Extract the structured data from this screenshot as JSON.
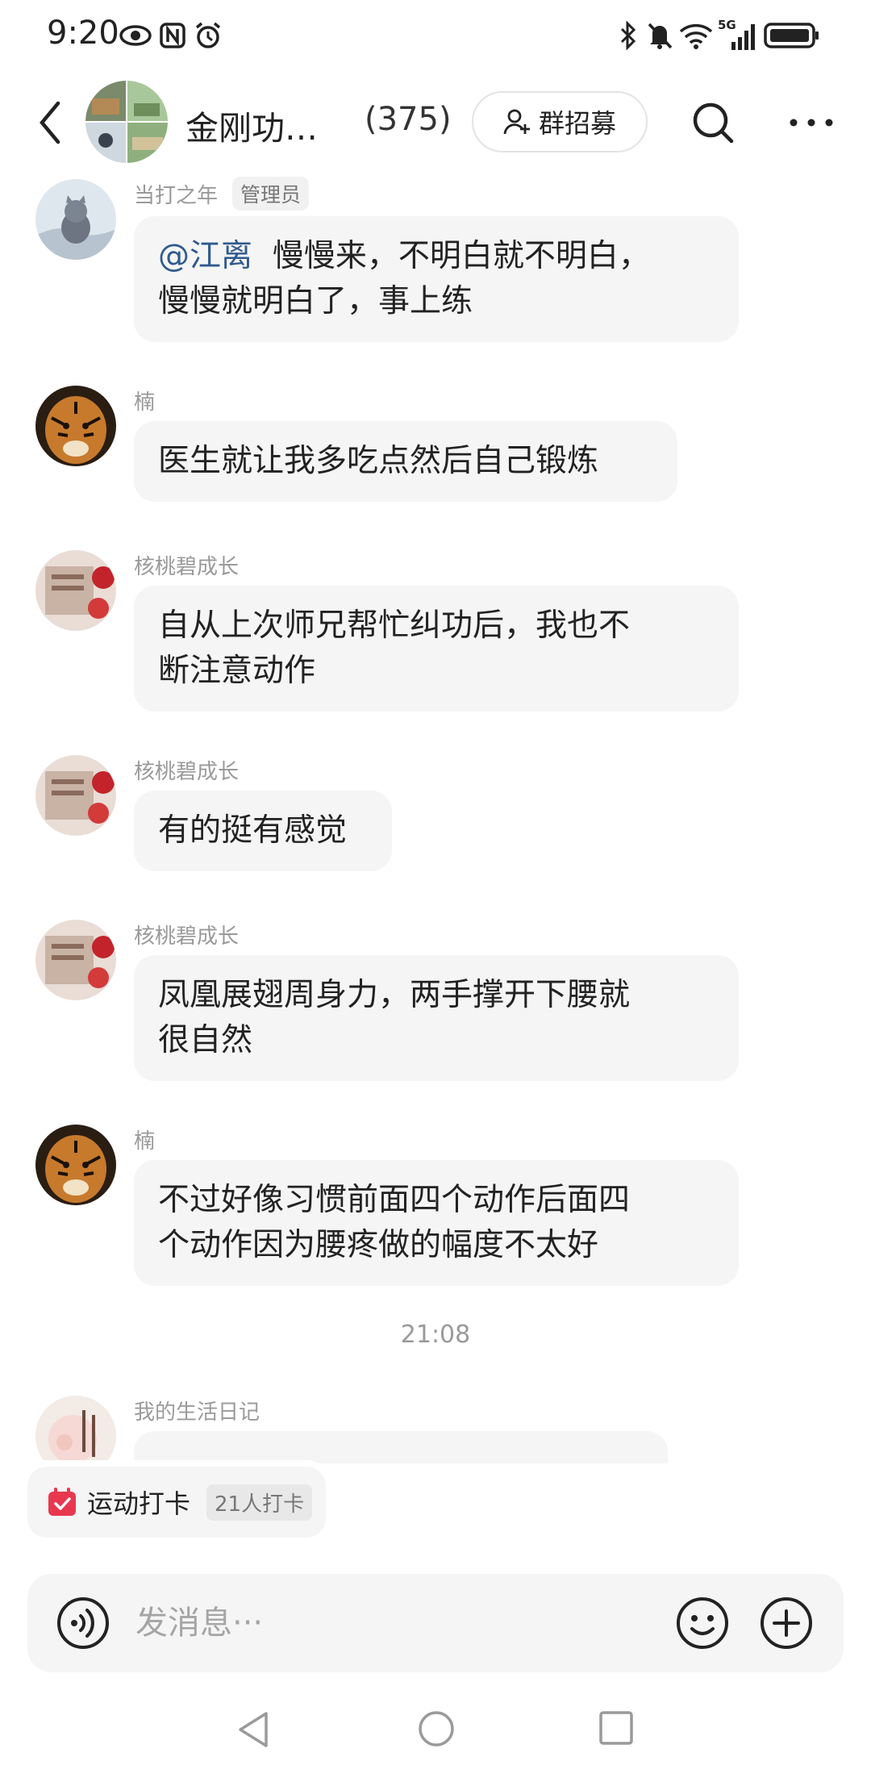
{
  "status_bar": {
    "time": "9:20",
    "icons": [
      "eye-icon",
      "nfc-icon",
      "alarm-icon",
      "bluetooth-icon",
      "mute-icon",
      "wifi-icon",
      "signal-5g-icon",
      "battery-icon"
    ],
    "network": "5G"
  },
  "header": {
    "group_name": "金刚功…",
    "member_count": "(375)",
    "recruit_label": "群招募"
  },
  "messages": [
    {
      "sender": "当打之年",
      "role": "管理员",
      "mention": "@江离",
      "text_line1": "慢慢来，不明白就不明白，",
      "text_line2": "慢慢就明白了，事上练"
    },
    {
      "sender": "楠",
      "text_line1": "医生就让我多吃点然后自己锻炼"
    },
    {
      "sender": "核桃碧成长",
      "text_line1": "自从上次师兄帮忙纠功后，我也不",
      "text_line2": "断注意动作"
    },
    {
      "sender": "核桃碧成长",
      "text_line1": "有的挺有感觉"
    },
    {
      "sender": "核桃碧成长",
      "text_line1": "凤凰展翅周身力，两手撑开下腰就",
      "text_line2": "很自然"
    },
    {
      "sender": "楠",
      "text_line1": "不过好像习惯前面四个动作后面四",
      "text_line2": "个动作因为腰疼做的幅度不太好"
    }
  ],
  "timestamp": "21:08",
  "partial_message": {
    "sender": "我的生活日记"
  },
  "checkin": {
    "label": "运动打卡",
    "count": "21人打卡"
  },
  "input": {
    "placeholder": "发消息···"
  },
  "colors": {
    "mention": "#2f5a8e",
    "bubble": "#f5f5f5",
    "checkin_icon": "#e8384f"
  }
}
